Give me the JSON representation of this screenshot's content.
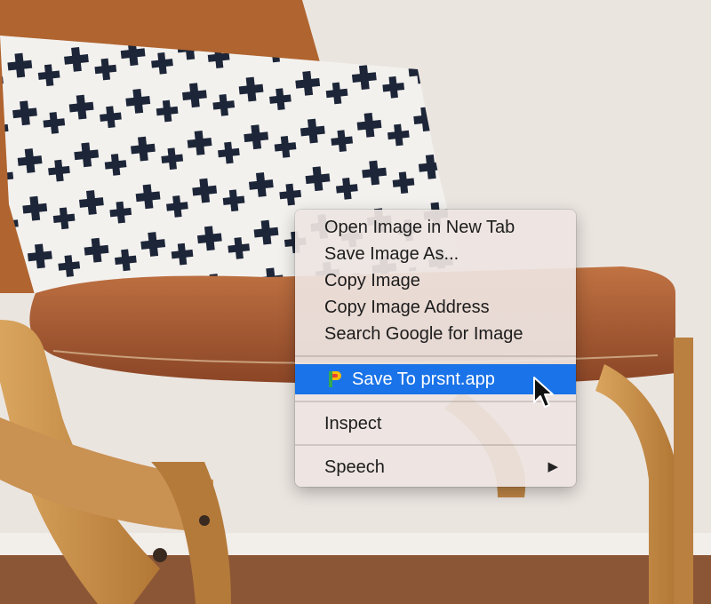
{
  "context_menu": {
    "items": [
      {
        "label": "Open Image in New Tab"
      },
      {
        "label": "Save Image As..."
      },
      {
        "label": "Copy Image"
      },
      {
        "label": "Copy Image Address"
      },
      {
        "label": "Search Google for Image"
      }
    ],
    "extension_item": {
      "label": "Save To prsnt.app",
      "icon": "prsnt-app-icon",
      "highlighted": true
    },
    "inspect": {
      "label": "Inspect"
    },
    "speech": {
      "label": "Speech",
      "submenu_arrow": "▶"
    }
  },
  "colors": {
    "highlight": "#1a73e8",
    "menu_background": "#eee5e2",
    "wall": "#ece6e1",
    "leather": "#a45a32",
    "wood": "#c48a45",
    "floor": "#8a5334"
  }
}
